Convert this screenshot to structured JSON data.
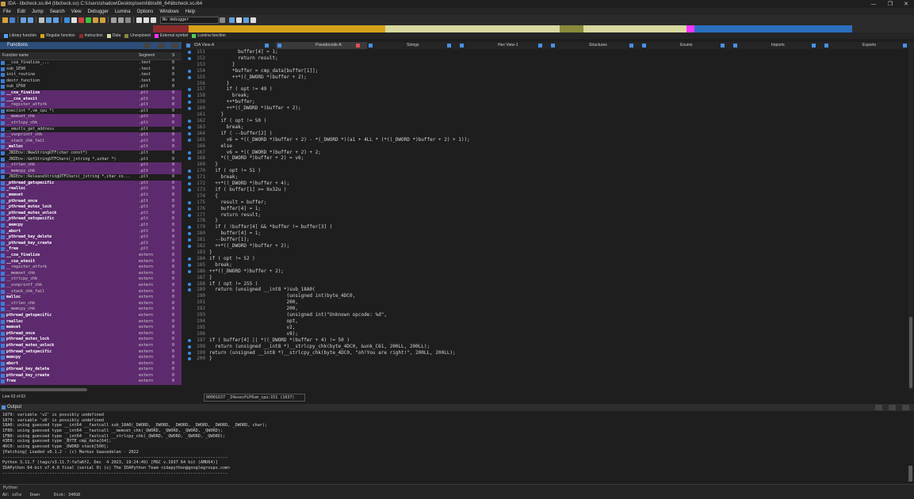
{
  "window": {
    "title": "IDA - libcheck.so.i64 (libcheck.so) C:\\Users\\shadow\\Desktop\\semi\\lib\\x86_64\\libcheck.so.i64",
    "controls": [
      "—",
      "❐",
      "✕"
    ]
  },
  "menu": [
    "File",
    "Edit",
    "Jump",
    "Search",
    "View",
    "Debugger",
    "Lumina",
    "Options",
    "Windows",
    "Help"
  ],
  "toolbar": {
    "debugger": "No debugger"
  },
  "legend": [
    {
      "label": "Library function",
      "color": "#5aa0ff"
    },
    {
      "label": "Regular function",
      "color": "#d6a21a"
    },
    {
      "label": "Instruction",
      "color": "#8b2b2b"
    },
    {
      "label": "Data",
      "color": "#d8d8a0"
    },
    {
      "label": "Unexplored",
      "color": "#8a8a3a"
    },
    {
      "label": "External symbol",
      "color": "#ff33ff"
    },
    {
      "label": "Lumina function",
      "color": "#55cc55"
    }
  ],
  "functions_panel": {
    "title": "Functions",
    "columns": [
      "Function name",
      "Segment",
      "S"
    ],
    "status": "Line 63 of 63",
    "rows": [
      {
        "name": "__cxa_finalize_...",
        "seg": ".text",
        "s": "0",
        "hl": false,
        "bold": false
      },
      {
        "name": "sub_1E90",
        "seg": ".text",
        "s": "0",
        "hl": false,
        "bold": false
      },
      {
        "name": "init_routine",
        "seg": ".text",
        "s": "0",
        "hl": false,
        "bold": false
      },
      {
        "name": "destr_function",
        "seg": ".text",
        "s": "0",
        "hl": false,
        "bold": false
      },
      {
        "name": "sub_1F60",
        "seg": ".plt",
        "s": "0",
        "hl": false,
        "bold": false
      },
      {
        "name": "__cxa_finalize",
        "seg": ".plt",
        "s": "0",
        "hl": true,
        "bold": true
      },
      {
        "name": "___cxa_atexit",
        "seg": ".plt",
        "s": "0",
        "hl": true,
        "bold": true
      },
      {
        "name": "__register_atfork",
        "seg": ".plt",
        "s": "0",
        "hl": true,
        "bold": false
      },
      {
        "name": "exec(int *,vm_cpu *)",
        "seg": ".plt",
        "s": "0",
        "hl": false,
        "bold": false
      },
      {
        "name": "__memset_chk",
        "seg": ".plt",
        "s": "0",
        "hl": true,
        "bold": false
      },
      {
        "name": "__strlcpy_chk",
        "seg": ".plt",
        "s": "0",
        "hl": true,
        "bold": false
      },
      {
        "name": "__emutls_get_address",
        "seg": ".plt",
        "s": "0",
        "hl": false,
        "bold": false
      },
      {
        "name": "__vsnprintf_chk",
        "seg": ".plt",
        "s": "0",
        "hl": true,
        "bold": false
      },
      {
        "name": "__stack_chk_fail",
        "seg": ".plt",
        "s": "0",
        "hl": true,
        "bold": false
      },
      {
        "name": "_malloc",
        "seg": ".plt",
        "s": "0",
        "hl": true,
        "bold": true
      },
      {
        "name": "_JNIEnv::NewStringUTF(char const*)",
        "seg": ".plt",
        "s": "0",
        "hl": false,
        "bold": false
      },
      {
        "name": "_JNIEnv::GetStringUTFChars(_jstring *,uchar *)",
        "seg": ".plt",
        "s": "0",
        "hl": false,
        "bold": false
      },
      {
        "name": "__strlen_chk",
        "seg": ".plt",
        "s": "0",
        "hl": true,
        "bold": false
      },
      {
        "name": "__memcpy_chk",
        "seg": ".plt",
        "s": "0",
        "hl": true,
        "bold": false
      },
      {
        "name": "_JNIEnv::ReleaseStringUTFChars(_jstring *,char co...",
        "seg": ".plt",
        "s": "0",
        "hl": false,
        "bold": false
      },
      {
        "name": "_pthread_getspecific",
        "seg": ".plt",
        "s": "0",
        "hl": true,
        "bold": true
      },
      {
        "name": "_realloc",
        "seg": ".plt",
        "s": "0",
        "hl": true,
        "bold": true
      },
      {
        "name": "_memset",
        "seg": ".plt",
        "s": "0",
        "hl": true,
        "bold": true
      },
      {
        "name": "_pthread_once",
        "seg": ".plt",
        "s": "0",
        "hl": true,
        "bold": true
      },
      {
        "name": "_pthread_mutex_lock",
        "seg": ".plt",
        "s": "0",
        "hl": true,
        "bold": true
      },
      {
        "name": "_pthread_mutex_unlock",
        "seg": ".plt",
        "s": "0",
        "hl": true,
        "bold": true
      },
      {
        "name": "_pthread_setspecific",
        "seg": ".plt",
        "s": "0",
        "hl": true,
        "bold": true
      },
      {
        "name": "_memcpy",
        "seg": ".plt",
        "s": "0",
        "hl": true,
        "bold": true
      },
      {
        "name": "_abort",
        "seg": ".plt",
        "s": "0",
        "hl": true,
        "bold": true
      },
      {
        "name": "_pthread_key_delete",
        "seg": ".plt",
        "s": "0",
        "hl": true,
        "bold": true
      },
      {
        "name": "_pthread_key_create",
        "seg": ".plt",
        "s": "0",
        "hl": true,
        "bold": true
      },
      {
        "name": "_free",
        "seg": ".plt",
        "s": "0",
        "hl": true,
        "bold": true
      },
      {
        "name": "__cxa_finalize",
        "seg": "extern",
        "s": "0",
        "hl": true,
        "bold": true
      },
      {
        "name": "__cxa_atexit",
        "seg": "extern",
        "s": "0",
        "hl": true,
        "bold": true
      },
      {
        "name": "__register_atfork",
        "seg": "extern",
        "s": "0",
        "hl": true,
        "bold": false
      },
      {
        "name": "__memset_chk",
        "seg": "extern",
        "s": "0",
        "hl": true,
        "bold": false
      },
      {
        "name": "__strlcpy_chk",
        "seg": "extern",
        "s": "0",
        "hl": true,
        "bold": false
      },
      {
        "name": "__vsnprintf_chk",
        "seg": "extern",
        "s": "0",
        "hl": true,
        "bold": false
      },
      {
        "name": "__stack_chk_fail",
        "seg": "extern",
        "s": "0",
        "hl": true,
        "bold": false
      },
      {
        "name": "malloc",
        "seg": "extern",
        "s": "0",
        "hl": true,
        "bold": true
      },
      {
        "name": "__strlen_chk",
        "seg": "extern",
        "s": "0",
        "hl": true,
        "bold": false
      },
      {
        "name": "__memcpy_chk",
        "seg": "extern",
        "s": "0",
        "hl": true,
        "bold": false
      },
      {
        "name": "pthread_getspecific",
        "seg": "extern",
        "s": "0",
        "hl": true,
        "bold": true
      },
      {
        "name": "realloc",
        "seg": "extern",
        "s": "0",
        "hl": true,
        "bold": true
      },
      {
        "name": "memset",
        "seg": "extern",
        "s": "0",
        "hl": true,
        "bold": true
      },
      {
        "name": "pthread_once",
        "seg": "extern",
        "s": "0",
        "hl": true,
        "bold": true
      },
      {
        "name": "pthread_mutex_lock",
        "seg": "extern",
        "s": "0",
        "hl": true,
        "bold": true
      },
      {
        "name": "pthread_mutex_unlock",
        "seg": "extern",
        "s": "0",
        "hl": true,
        "bold": true
      },
      {
        "name": "pthread_setspecific",
        "seg": "extern",
        "s": "0",
        "hl": true,
        "bold": true
      },
      {
        "name": "memcpy",
        "seg": "extern",
        "s": "0",
        "hl": true,
        "bold": true
      },
      {
        "name": "abort",
        "seg": "extern",
        "s": "0",
        "hl": true,
        "bold": true
      },
      {
        "name": "pthread_key_delete",
        "seg": "extern",
        "s": "0",
        "hl": true,
        "bold": true
      },
      {
        "name": "pthread_key_create",
        "seg": "extern",
        "s": "0",
        "hl": true,
        "bold": true
      },
      {
        "name": "free",
        "seg": "extern",
        "s": "0",
        "hl": true,
        "bold": true
      }
    ]
  },
  "tabs": [
    "IDA View-A",
    "Pseudocode-A",
    "Strings",
    "Hex View-1",
    "Structures",
    "Enums",
    "Imports",
    "Exports"
  ],
  "active_tab": 1,
  "code_lines": [
    {
      "n": "151",
      "dot": true,
      "t": "          buffer[4] = 1;"
    },
    {
      "n": "152",
      "dot": true,
      "t": "          return result;"
    },
    {
      "n": "153",
      "dot": false,
      "t": "        }"
    },
    {
      "n": "154",
      "dot": true,
      "t": "        *buffer = cmp_data[buffer[1]];"
    },
    {
      "n": "155",
      "dot": true,
      "t": "        ++*((_DWORD *)buffer + 2);"
    },
    {
      "n": "156",
      "dot": false,
      "t": "      }"
    },
    {
      "n": "157",
      "dot": true,
      "t": "      if ( opt != 49 )"
    },
    {
      "n": "158",
      "dot": true,
      "t": "        break;"
    },
    {
      "n": "159",
      "dot": true,
      "t": "      ++*buffer;"
    },
    {
      "n": "160",
      "dot": true,
      "t": "      ++*((_DWORD *)buffer + 2);"
    },
    {
      "n": "161",
      "dot": false,
      "t": "    }"
    },
    {
      "n": "162",
      "dot": true,
      "t": "    if ( opt != 50 )"
    },
    {
      "n": "163",
      "dot": true,
      "t": "      break;"
    },
    {
      "n": "164",
      "dot": true,
      "t": "    if ( --buffer[2] )"
    },
    {
      "n": "165",
      "dot": true,
      "t": "      v6 = *((_DWORD *)buffer + 2) - *(_DWORD *)(a1 + 4LL * (*((_DWORD *)buffer + 2) + 1));"
    },
    {
      "n": "166",
      "dot": false,
      "t": "    else"
    },
    {
      "n": "167",
      "dot": true,
      "t": "      v6 = *((_DWORD *)buffer + 2) + 2;"
    },
    {
      "n": "168",
      "dot": true,
      "t": "    *((_DWORD *)buffer + 2) = v6;"
    },
    {
      "n": "169",
      "dot": false,
      "t": "  }"
    },
    {
      "n": "170",
      "dot": true,
      "t": "  if ( opt != 51 )"
    },
    {
      "n": "171",
      "dot": true,
      "t": "    break;"
    },
    {
      "n": "172",
      "dot": true,
      "t": "  ++*((_DWORD *)buffer + 4);"
    },
    {
      "n": "173",
      "dot": true,
      "t": "  if ( buffer[1] >= 0x32u )"
    },
    {
      "n": "174",
      "dot": false,
      "t": "  {"
    },
    {
      "n": "175",
      "dot": true,
      "t": "    result = buffer;"
    },
    {
      "n": "176",
      "dot": true,
      "t": "    buffer[4] = 1;"
    },
    {
      "n": "177",
      "dot": true,
      "t": "    return result;"
    },
    {
      "n": "178",
      "dot": false,
      "t": "  }"
    },
    {
      "n": "179",
      "dot": true,
      "t": "  if ( !buffer[4] && *buffer != buffer[3] )"
    },
    {
      "n": "180",
      "dot": true,
      "t": "    buffer[4] = 1;"
    },
    {
      "n": "181",
      "dot": true,
      "t": "  --buffer[1];"
    },
    {
      "n": "182",
      "dot": true,
      "t": "  ++*((_DWORD *)buffer + 2);"
    },
    {
      "n": "183",
      "dot": false,
      "t": "}"
    },
    {
      "n": "184",
      "dot": true,
      "t": "if ( opt != 52 )"
    },
    {
      "n": "185",
      "dot": true,
      "t": "  break;"
    },
    {
      "n": "186",
      "dot": true,
      "t": "++*((_DWORD *)buffer + 2);"
    },
    {
      "n": "187",
      "dot": false,
      "t": "}"
    },
    {
      "n": "188",
      "dot": true,
      "t": "if ( opt != 255 )"
    },
    {
      "n": "189",
      "dot": true,
      "t": "  return (unsigned __int8 *)sub_18A0("
    },
    {
      "n": "190",
      "dot": false,
      "t": "                           (unsigned int)byte_4DC0,"
    },
    {
      "n": "191",
      "dot": false,
      "t": "                           200,"
    },
    {
      "n": "192",
      "dot": false,
      "t": "                           200,"
    },
    {
      "n": "193",
      "dot": false,
      "t": "                           (unsigned int)\"Unknown opcode: %d\","
    },
    {
      "n": "194",
      "dot": false,
      "t": "                           opt,"
    },
    {
      "n": "195",
      "dot": false,
      "t": "                           v2,"
    },
    {
      "n": "196",
      "dot": false,
      "t": "                           v8);"
    },
    {
      "n": "197",
      "dot": true,
      "t": "if ( buffer[4] || *((_DWORD *)buffer + 4) != 50 )"
    },
    {
      "n": "198",
      "dot": true,
      "t": "  return (unsigned __int8 *)__strlcpy_chk(byte_4DC0, &unk_C61, 200LL, 200LL);"
    },
    {
      "n": "199",
      "dot": true,
      "t": "return (unsigned __int8 *)__strlcpy_chk(byte_4DC0, \"oh!You are right!\", 200LL, 200LL);"
    },
    {
      "n": "200",
      "dot": true,
      "t": "}"
    }
  ],
  "address_box": "00001637 _Z4execPiP6vm_cpu:151 (1637)",
  "output": {
    "title": "Output",
    "lines": [
      "1879: variable 'v2' is possibly undefined",
      "1879: variable 'v8' is possibly undefined",
      "18A0: using guessed type __int64 __fastcall sub_18A0(_DWORD, _DWORD, _DWORD, _DWORD, _DWORD, _DWORD, char);",
      "1F80: using guessed type __int64 __fastcall __memset_chk(_QWORD, _QWORD, _QWORD, _QWORD);",
      "1FB0: using guessed type __int64 __fastcall __strlcpy_chk(_QWORD, _QWORD, _QWORD, _QWORD);",
      "43E0: using guessed type _BYTE cmp_data[64];",
      "4DC0: using guessed type _DWORD stack[500];",
      "[Patching] Loaded v0.1.2 - (c) Markus Gaasedelen - 2022",
      "-------------------------------------------------------------------------------------------",
      "Python 3.11.7 (tags/v3.11.7:fa7a6f2, Dec  4 2023, 19:24:49) [MSC v.1937 64 bit (AMD64)]",
      "IDAPython 64-bit v7.4.0 final (serial 0) (c) The IDAPython Team <idapython@googlegroups.com>",
      "-------------------------------------------------------------------------------------------"
    ],
    "python_label": "Python"
  },
  "status": {
    "au": "AU:  idle",
    "dir": "Down",
    "disk": "Disk: 340GB"
  }
}
